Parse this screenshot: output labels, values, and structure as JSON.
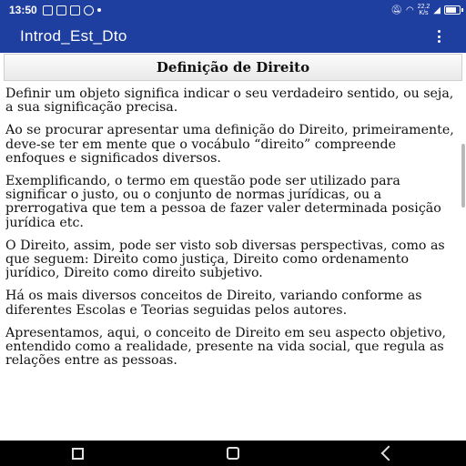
{
  "status_bar": {
    "time": "13:50",
    "network_speed_value": "22.2",
    "network_speed_unit": "K/s",
    "battery_level": 0.7
  },
  "app_bar": {
    "title": "Introd_Est_Dto",
    "overflow_icon": "more-vert-icon"
  },
  "section": {
    "title": "Definição de Direito"
  },
  "paragraphs": [
    "Definir um objeto significa indicar o seu verdadeiro sentido, ou seja, a sua significação precisa.",
    "Ao se procurar apresentar uma definição do Direito, primeiramente, deve-se ter em mente que o vocábulo “direito” compreende enfoques e significados diversos.",
    "Exemplificando, o termo em questão pode ser utilizado para significar o justo, ou o conjunto de normas jurídicas, ou a prerrogativa que tem a pessoa de fazer valer determinada posição jurídica etc.",
    "O Direito, assim, pode ser visto sob diversas perspectivas, como as que seguem: Direito como justiça, Direito como ordenamento jurídico, Direito como direito subjetivo.",
    "Há os mais diversos conceitos de Direito, variando conforme as diferentes Escolas e Teorias seguidas pelos autores.",
    "Apresentamos, aqui, o conceito de Direito em seu aspecto objetivo, entendido como a realidade, presente na vida social, que regula as relações entre as pessoas."
  ],
  "colors": {
    "primary": "#1f3fa0",
    "navbar": "#000000"
  }
}
